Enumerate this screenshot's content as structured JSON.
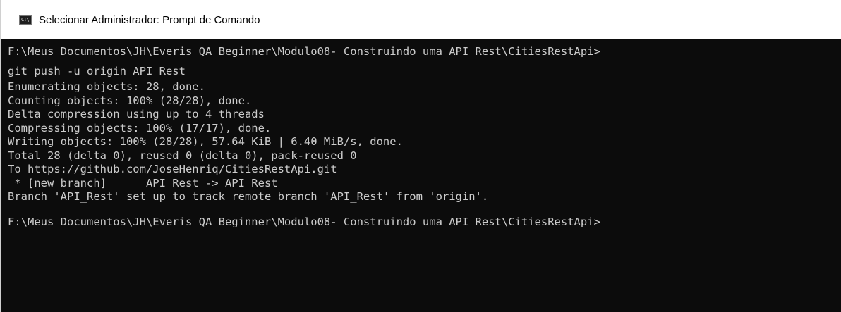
{
  "window": {
    "title": "Selecionar Administrador: Prompt de Comando",
    "icon_text": "C:\\"
  },
  "console": {
    "prompt1": "F:\\Meus Documentos\\JH\\Everis QA Beginner\\Modulo08- Construindo uma API Rest\\CitiesRestApi>",
    "command": "git push -u origin API_Rest",
    "output": [
      "Enumerating objects: 28, done.",
      "Counting objects: 100% (28/28), done.",
      "Delta compression using up to 4 threads",
      "Compressing objects: 100% (17/17), done.",
      "Writing objects: 100% (28/28), 57.64 KiB | 6.40 MiB/s, done.",
      "Total 28 (delta 0), reused 0 (delta 0), pack-reused 0",
      "To https://github.com/JoseHenriq/CitiesRestApi.git",
      " * [new branch]      API_Rest -> API_Rest",
      "Branch 'API_Rest' set up to track remote branch 'API_Rest' from 'origin'."
    ],
    "prompt2": "F:\\Meus Documentos\\JH\\Everis QA Beginner\\Modulo08- Construindo uma API Rest\\CitiesRestApi>"
  },
  "colors": {
    "console_bg": "#0c0c0c",
    "console_text": "#cccccc",
    "titlebar_bg": "#ffffff"
  }
}
